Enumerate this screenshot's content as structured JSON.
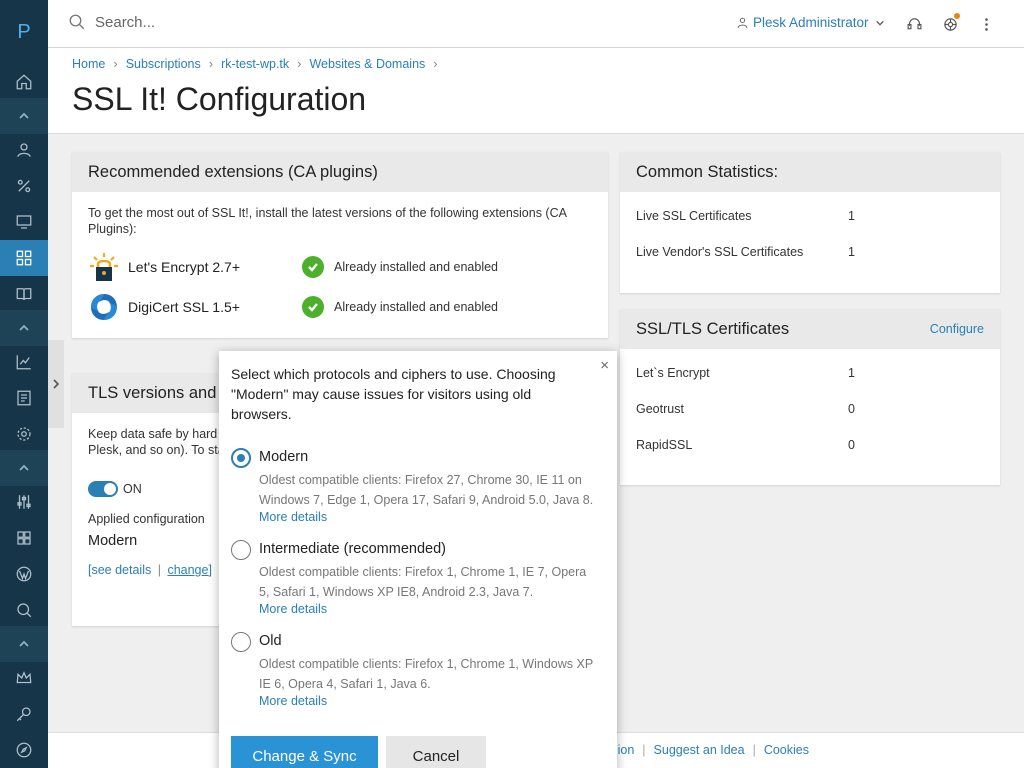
{
  "app": {
    "logo": "P"
  },
  "sidebar": {
    "items": [
      {
        "name": "home-icon"
      },
      {
        "name": "user-icon"
      },
      {
        "name": "percent-icon"
      },
      {
        "name": "monitor-icon"
      },
      {
        "name": "apps-icon"
      },
      {
        "name": "book-icon"
      },
      {
        "name": "chart-icon"
      },
      {
        "name": "list-icon"
      },
      {
        "name": "gear-icon"
      },
      {
        "name": "sliders-icon"
      },
      {
        "name": "puzzle-icon"
      },
      {
        "name": "wordpress-icon"
      },
      {
        "name": "search-doc-icon"
      },
      {
        "name": "crown-icon"
      },
      {
        "name": "key-icon"
      },
      {
        "name": "compass-icon"
      }
    ]
  },
  "topbar": {
    "search_placeholder": "Search...",
    "user_label": "Plesk Administrator"
  },
  "header": {
    "breadcrumb": [
      "Home",
      "Subscriptions",
      "rk-test-wp.tk",
      "Websites & Domains"
    ],
    "title": "SSL It! Configuration"
  },
  "extensions_card": {
    "title": "Recommended extensions (CA plugins)",
    "intro": "To get the most out of SSL It!, install the latest versions of the following extensions (CA Plugins):",
    "items": [
      {
        "name": "Let's Encrypt 2.7+",
        "status": "Already installed and enabled"
      },
      {
        "name": "DigiCert SSL 1.5+",
        "status": "Already installed and enabled"
      }
    ]
  },
  "tls_card": {
    "title": "TLS versions and",
    "desc_line1": "Keep data safe by hard",
    "desc_line2": "Plesk, and so on). To sta",
    "toggle_label": "ON",
    "applied_label": "Applied configuration",
    "applied_value": "Modern",
    "see_details": "[see details",
    "separator": "|",
    "change": "change]"
  },
  "stats_card": {
    "title": "Common Statistics:",
    "rows": [
      {
        "label": "Live SSL Certificates",
        "value": "1"
      },
      {
        "label": "Live Vendor's SSL Certificates",
        "value": "1"
      }
    ]
  },
  "certs_card": {
    "title": "SSL/TLS Certificates",
    "configure": "Configure",
    "rows": [
      {
        "label": "Let`s Encrypt",
        "value": "1"
      },
      {
        "label": "Geotrust",
        "value": "0"
      },
      {
        "label": "RapidSSL",
        "value": "0"
      }
    ]
  },
  "popover": {
    "intro": "Select which protocols and ciphers to use. Choosing \"Modern\" may cause issues for visitors using old browsers.",
    "close": "×",
    "options": [
      {
        "label": "Modern",
        "desc": "Oldest compatible clients: Firefox 27, Chrome 30, IE 11 on Windows 7, Edge 1, Opera 17, Safari 9, Android 5.0, Java 8.",
        "more": "More details",
        "checked": true
      },
      {
        "label": "Intermediate (recommended)",
        "desc": "Oldest compatible clients: Firefox 1, Chrome 1, IE 7, Opera 5, Safari 1, Windows XP IE8, Android 2.3, Java 7.",
        "more": "More details",
        "checked": false
      },
      {
        "label": "Old",
        "desc": "Oldest compatible clients: Firefox 1, Chrome 1, Windows XP IE 6, Opera 4, Safari 1, Java 6.",
        "more": "More details",
        "checked": false
      }
    ],
    "submit": "Change & Sync",
    "cancel": "Cancel"
  },
  "footer": {
    "links": [
      "n Opinion",
      "Suggest an Idea",
      "Cookies"
    ]
  },
  "colors": {
    "accent": "#2a7fb5",
    "sidebar": "#163548",
    "success": "#4db02c"
  }
}
